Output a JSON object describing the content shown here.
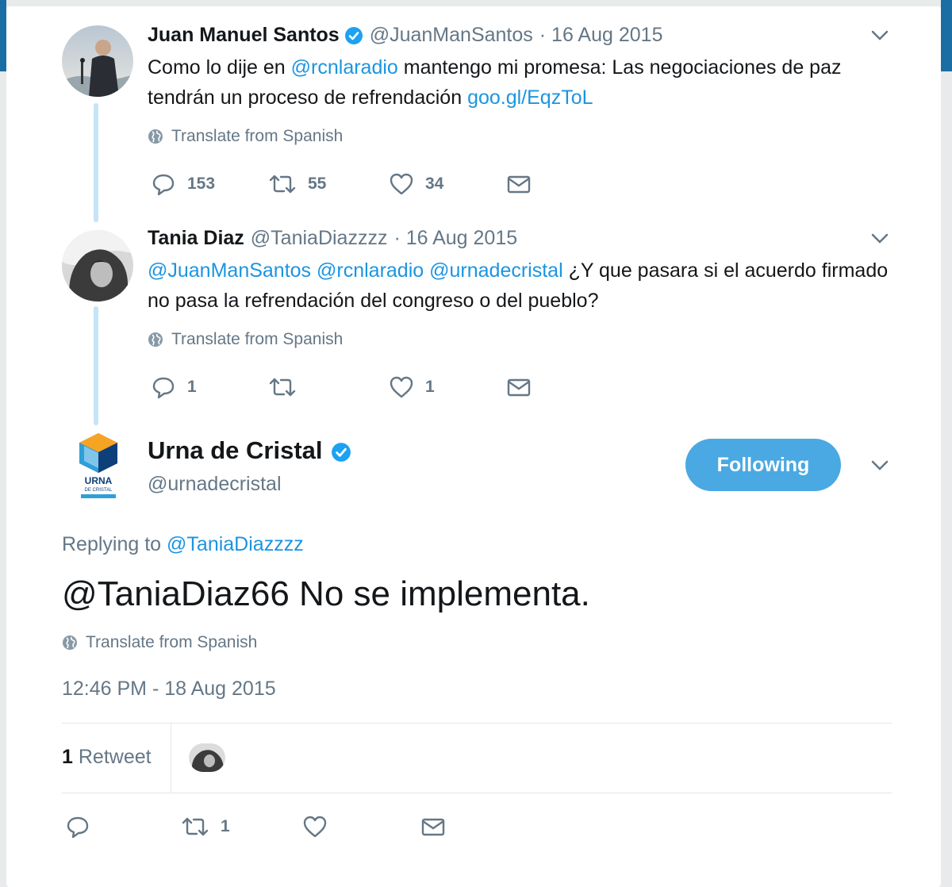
{
  "thread": [
    {
      "name": "Juan Manuel Santos",
      "verified": true,
      "handle": "@JuanManSantos",
      "date": "· 16 Aug 2015",
      "text_plain_1": "Como lo dije en ",
      "mention_1": "@rcnlaradio",
      "text_plain_2": " mantengo mi promesa: Las negociaciones de paz tendrán un proceso de refrendación ",
      "link": "goo.gl/EqzToL",
      "translate": "Translate from Spanish",
      "replies": "153",
      "retweets": "55",
      "likes": "34"
    },
    {
      "name": "Tania Diaz",
      "verified": false,
      "handle": "@TaniaDiazzzz",
      "date": "· 16 Aug 2015",
      "mention_1": "@JuanManSantos",
      "mention_2": "@rcnlaradio",
      "mention_3": "@urnadecristal",
      "text_plain": " ¿Y que pasara si el acuerdo firmado no pasa la refrendación del congreso o del pueblo?",
      "translate": "Translate from Spanish",
      "replies": "1",
      "retweets": "",
      "likes": "1"
    }
  ],
  "main_tweet": {
    "name": "Urna de Cristal",
    "verified": true,
    "handle": "@urnadecristal",
    "follow_label": "Following",
    "logo_text_1": "URNA",
    "logo_text_2": "DE CRISTAL",
    "replying_prefix": "Replying to ",
    "replying_to": "@TaniaDiazzzz",
    "text": "@TaniaDiaz66 No se implementa.",
    "translate": "Translate from Spanish",
    "timestamp": "12:46 PM - 18 Aug 2015",
    "retweet_count": "1",
    "retweet_label": "Retweet",
    "replies": "",
    "retweets": "1",
    "likes": ""
  },
  "colors": {
    "accent": "#1b95e0",
    "button": "#4aa8e2",
    "thread_line": "#c4e4f7",
    "muted": "#657786"
  }
}
